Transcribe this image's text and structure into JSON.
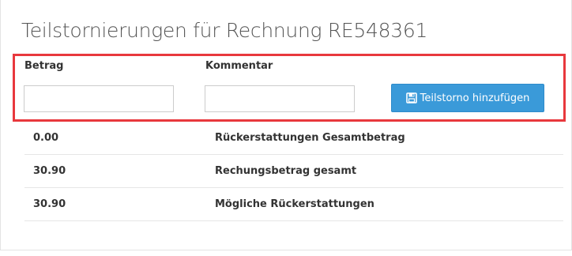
{
  "title": "Teilstornierungen für Rechnung RE548361",
  "form": {
    "amount_header": "Betrag",
    "comment_header": "Kommentar",
    "amount_value": "",
    "comment_value": "",
    "add_button_label": "Teilstorno hinzufügen",
    "add_button_icon": "save-icon",
    "button_color": "#3a9ad9",
    "highlight_color": "#e8383d"
  },
  "summary": [
    {
      "value": "0.00",
      "label": "Rückerstattungen Gesamtbetrag"
    },
    {
      "value": "30.90",
      "label": "Rechungsbetrag gesamt"
    },
    {
      "value": "30.90",
      "label": "Mögliche Rückerstattungen"
    }
  ]
}
